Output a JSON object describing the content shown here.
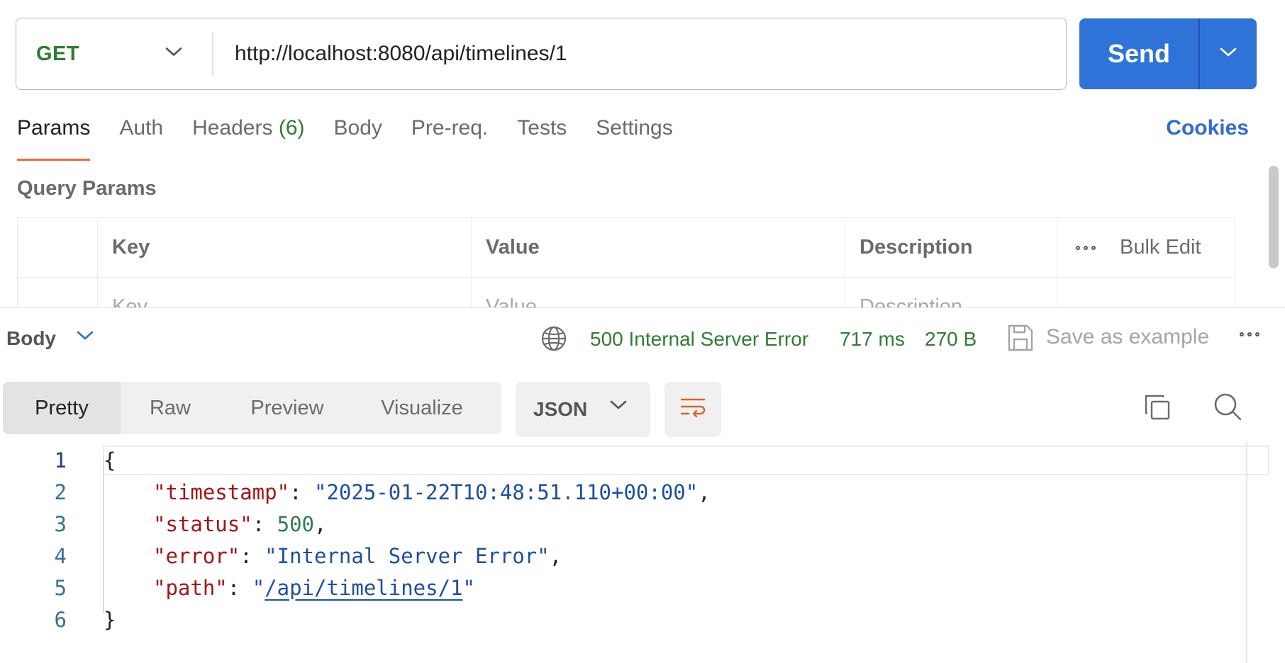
{
  "request": {
    "method": "GET",
    "url": "http://localhost:8080/api/timelines/1",
    "send_label": "Send"
  },
  "request_tabs": [
    {
      "label": "Params",
      "active": true
    },
    {
      "label": "Auth"
    },
    {
      "label": "Headers",
      "count": "(6)"
    },
    {
      "label": "Body"
    },
    {
      "label": "Pre-req."
    },
    {
      "label": "Tests"
    },
    {
      "label": "Settings"
    }
  ],
  "cookies_label": "Cookies",
  "query_params": {
    "title": "Query Params",
    "columns": [
      "Key",
      "Value",
      "Description"
    ],
    "bulk_edit": "Bulk Edit",
    "placeholders": {
      "key": "Key",
      "value": "Value",
      "description": "Description"
    }
  },
  "response": {
    "body_label": "Body",
    "status": "500 Internal Server Error",
    "time": "717 ms",
    "size": "270 B",
    "save_example": "Save as example",
    "view_tabs": [
      "Pretty",
      "Raw",
      "Preview",
      "Visualize"
    ],
    "active_view": "Pretty",
    "format": "JSON",
    "code_lines": [
      {
        "num": "1",
        "text": "{"
      },
      {
        "num": "2",
        "key": "\"timestamp\"",
        "value": "\"2025-01-22T10:48:51.110+00:00\"",
        "trail": ","
      },
      {
        "num": "3",
        "key": "\"status\"",
        "value": "500",
        "trail": ","
      },
      {
        "num": "4",
        "key": "\"error\"",
        "value": "\"Internal Server Error\"",
        "trail": ","
      },
      {
        "num": "5",
        "key": "\"path\"",
        "value_open": "\"",
        "value_link": "/api/timelines/1",
        "value_close": "\""
      },
      {
        "num": "6",
        "text": "}"
      }
    ]
  },
  "colors": {
    "accent": "#2f73d9",
    "method": "#2e7d32",
    "status_ok": "#2e7d32",
    "active_tab_underline": "#f26b3a"
  },
  "icons": [
    "chevron-down-icon",
    "globe-icon",
    "save-icon",
    "more-dots-icon",
    "wrap-lines-icon",
    "copy-icon",
    "search-icon"
  ]
}
